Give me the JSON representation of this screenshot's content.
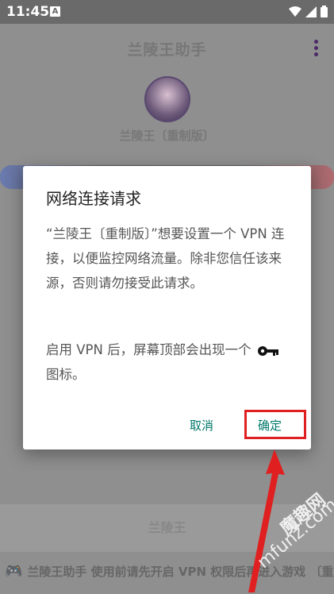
{
  "status_bar": {
    "time": "11:45",
    "icons": [
      "notification-a-icon",
      "wifi-icon",
      "signal-icon",
      "battery-icon"
    ]
  },
  "background_app": {
    "title": "兰陵王助手",
    "menu_icon": "more-vert-icon",
    "subtitle": "兰陵王〔重制版〕",
    "main_button_label": "兰陵王",
    "bottom_marquee": "兰陵王助手 使用前请先开启 VPN 权限后再进入游戏 〔重制版〕",
    "bottom_icon": "gamepad-icon"
  },
  "dialog": {
    "title": "网络连接请求",
    "message": "“兰陵王〔重制版〕”想要设置一个 VPN 连接，以便监控网络流量。除非您信任该来源，否则请勿接受此请求。",
    "message2_before": "启用 VPN 后，屏幕顶部会出现一个",
    "message2_after": "图标。",
    "key_icon": "key-icon",
    "cancel_label": "取消",
    "ok_label": "确定"
  },
  "annotation": {
    "highlight_color": "#e02020"
  },
  "watermark": {
    "line1": "魔趣网",
    "line2": "mfunz.com"
  },
  "colors": {
    "accent": "#00796b",
    "dialog_bg": "#ffffff",
    "scrim": "#8c8c8c"
  }
}
